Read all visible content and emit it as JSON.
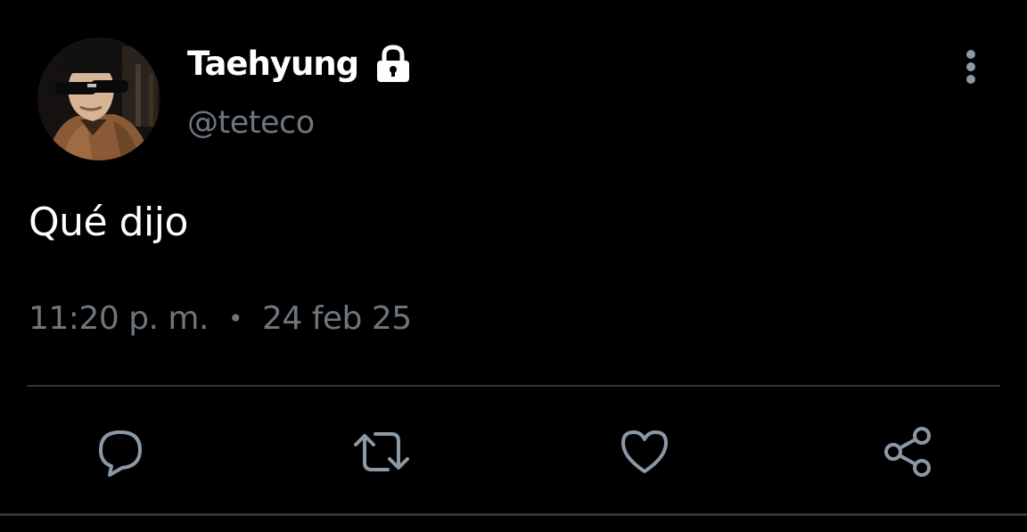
{
  "user": {
    "display_name": "Taehyung",
    "handle": "@teteco",
    "protected_icon": "lock-icon",
    "avatar": "profile-photo"
  },
  "tweet": {
    "text": "Qué dijo",
    "time": "11:20 p. m.",
    "separator": "•",
    "date": "24 feb 25"
  },
  "actions": [
    {
      "name": "reply",
      "icon": "reply-icon"
    },
    {
      "name": "retweet",
      "icon": "retweet-icon"
    },
    {
      "name": "like",
      "icon": "heart-icon"
    },
    {
      "name": "share",
      "icon": "share-icon"
    }
  ],
  "menu": {
    "icon": "more-vertical-icon"
  },
  "colors": {
    "background": "#000000",
    "text_primary": "#ffffff",
    "text_secondary": "#6e767d",
    "icon": "#8b98a5",
    "divider": "#2f3336"
  }
}
